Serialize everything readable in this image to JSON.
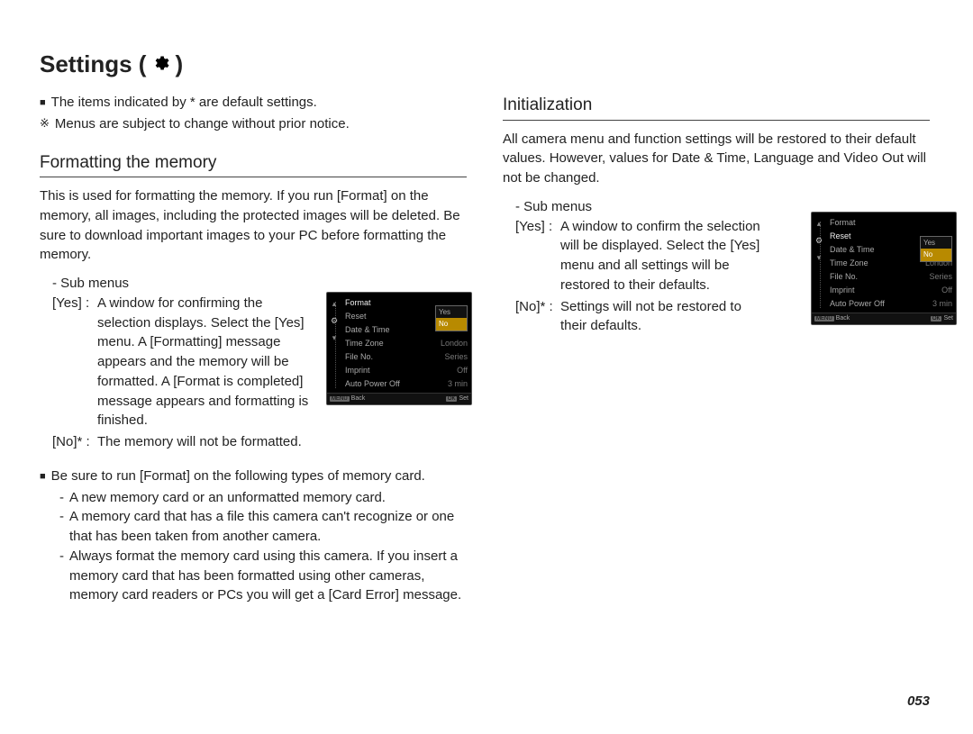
{
  "title_prefix": "Settings (",
  "title_suffix": ")",
  "intro": {
    "line1": "The items indicated by * are default settings.",
    "line2": "Menus are subject to change without prior notice."
  },
  "left": {
    "heading": "Formatting the memory",
    "para": "This is used for formatting the memory. If you run [Format] on the memory, all images, including the protected images will be deleted. Be sure to download important images to your PC before formatting the memory.",
    "sub_label": "- Sub menus",
    "yes_key": "[Yes] :",
    "yes_val": "A window for confirming the selection displays. Select the [Yes] menu. A [Formatting] message appears and the memory will be formatted. A [Format is completed] message appears and formatting is finished.",
    "no_key": "[No]* :",
    "no_val": "The memory will not be formatted.",
    "note_lead": "Be sure to run [Format] on the following types of memory card.",
    "note_items": [
      "A new memory card or an unformatted memory card.",
      "A memory card that has a file this camera can't recognize or one that has been taken from another camera.",
      "Always format the memory card using this camera. If you insert a memory card that has been formatted using other cameras, memory card readers or PCs you will get a [Card Error] message."
    ]
  },
  "right": {
    "heading": "Initialization",
    "para": "All camera menu and function settings will be restored to their default values. However, values for Date & Time, Language and Video Out will not be changed.",
    "sub_label": "- Sub menus",
    "yes_key": "[Yes] :",
    "yes_val": "A window to confirm the selection will be displayed. Select the [Yes] menu and all settings will be restored to their defaults.",
    "no_key": "[No]* :",
    "no_val": "Settings will not be restored to their defaults."
  },
  "screenshot": {
    "rows": [
      {
        "label": "Format",
        "value": ""
      },
      {
        "label": "Reset",
        "value": ""
      },
      {
        "label": "Date & Time",
        "value": ""
      },
      {
        "label": "Time Zone",
        "value": "London"
      },
      {
        "label": "File No.",
        "value": "Series"
      },
      {
        "label": "Imprint",
        "value": "Off"
      },
      {
        "label": "Auto Power Off",
        "value": "3 min"
      }
    ],
    "popup": {
      "opt1": "Yes",
      "opt2": "No"
    },
    "footer_back_key": "MENU",
    "footer_back": "Back",
    "footer_set_key": "OK",
    "footer_set": "Set"
  },
  "page_number": "053"
}
